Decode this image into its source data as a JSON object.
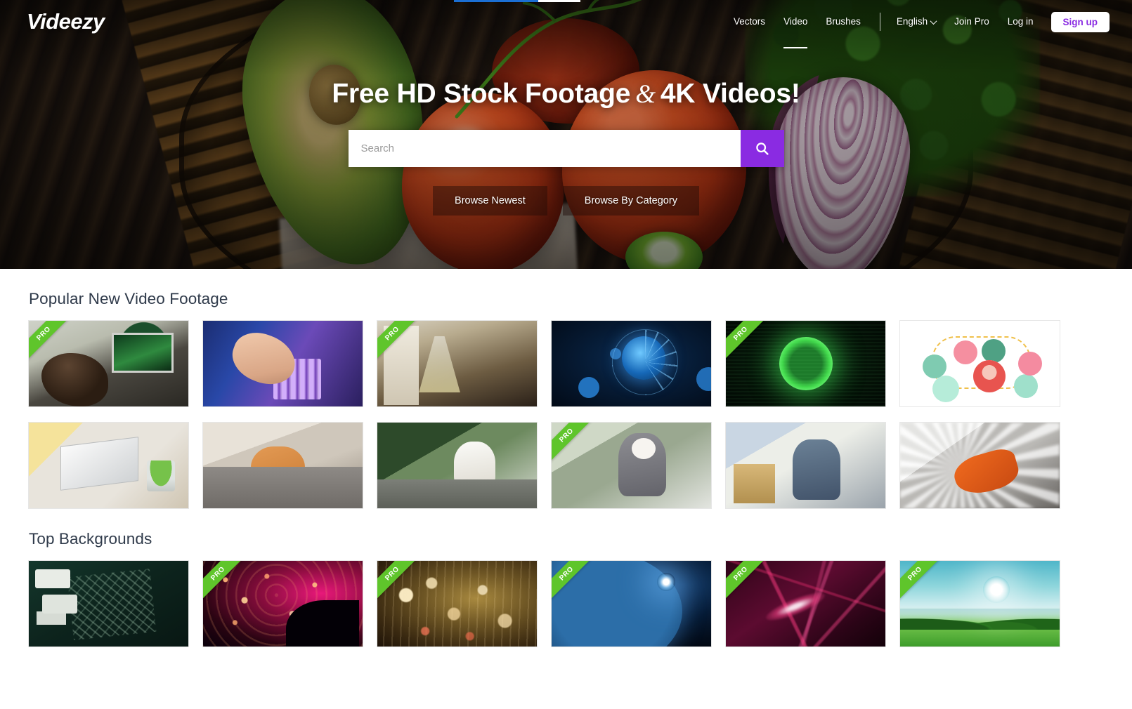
{
  "brand": {
    "name": "Videezy",
    "accent": "#8a2be2",
    "pro_green": "#5fc52b"
  },
  "nav": {
    "links": [
      {
        "label": "Vectors",
        "active": false
      },
      {
        "label": "Video",
        "active": true
      },
      {
        "label": "Brushes",
        "active": false
      }
    ],
    "language": "English",
    "join_pro": "Join Pro",
    "log_in": "Log in",
    "sign_up": "Sign up"
  },
  "hero": {
    "title_part1": "Free HD Stock Footage",
    "ampersand": "&",
    "title_part2": "4K Videos!",
    "search_placeholder": "Search",
    "search_value": "",
    "search_icon": "search-icon",
    "buttons": [
      {
        "label": "Browse Newest"
      },
      {
        "label": "Browse By Category"
      }
    ]
  },
  "sections": [
    {
      "title": "Popular New Video Footage",
      "cards": [
        {
          "alt": "Scientist looking into microscope",
          "pro": true,
          "art": "th-micro"
        },
        {
          "alt": "Gloved hand pipetting into test tubes",
          "pro": false,
          "art": "th-pipette"
        },
        {
          "alt": "Laboratory flask and researcher",
          "pro": true,
          "art": "th-lab"
        },
        {
          "alt": "Blue virus particles on dark background",
          "pro": false,
          "art": "th-virus"
        },
        {
          "alt": "Glowing green cell sphere",
          "pro": true,
          "art": "th-greensphere"
        },
        {
          "alt": "Flat illustration of online shopping icons",
          "pro": false,
          "art": "th-illus"
        },
        {
          "alt": "Hands typing on laptop with plant",
          "pro": false,
          "art": "th-laptop"
        },
        {
          "alt": "Couple relaxing on couch with phone",
          "pro": false,
          "art": "th-couch"
        },
        {
          "alt": "Woman working at cafe table",
          "pro": false,
          "art": "th-cafe"
        },
        {
          "alt": "Woman in face mask giving thumbs up",
          "pro": true,
          "art": "th-thumbsup"
        },
        {
          "alt": "Tired man at office desk",
          "pro": false,
          "art": "th-tired"
        },
        {
          "alt": "Orange glove cleaning surface",
          "pro": false,
          "art": "th-clean"
        }
      ]
    },
    {
      "title": "Top Backgrounds",
      "cards": [
        {
          "alt": "Dark teal circuit board macro",
          "pro": false,
          "art": "th-circuit"
        },
        {
          "alt": "Pink and orange bokeh light dots",
          "pro": true,
          "art": "th-bokeh-pink"
        },
        {
          "alt": "Golden falling bokeh particles",
          "pro": true,
          "art": "th-bokeh-gold"
        },
        {
          "alt": "Earth from space with sunrise",
          "pro": true,
          "art": "th-earth"
        },
        {
          "alt": "Magenta low poly abstract",
          "pro": true,
          "art": "th-poly"
        },
        {
          "alt": "Green landscape with sun and hills",
          "pro": true,
          "art": "th-landscape"
        }
      ]
    }
  ],
  "pro_badge_label": "PRO"
}
